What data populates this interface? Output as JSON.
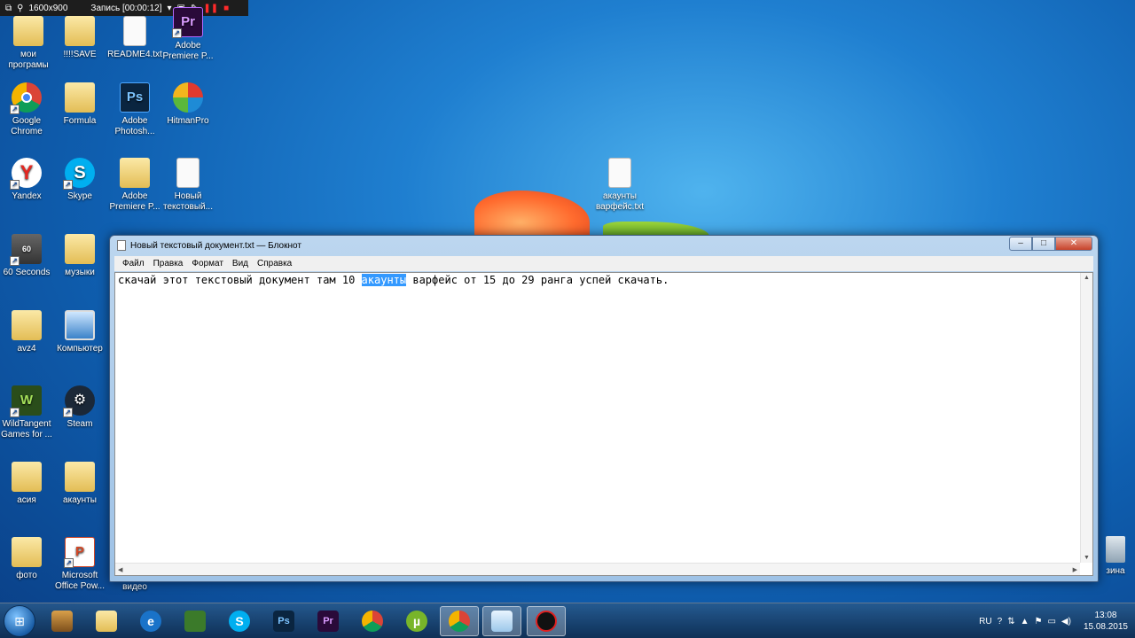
{
  "recorder": {
    "resolution": "1600x900",
    "status": "Запись [00:00:12]"
  },
  "desktop_icons": [
    {
      "label": "мои\nпрограмы"
    },
    {
      "label": "!!!!SAVE"
    },
    {
      "label": "README4.txt"
    },
    {
      "label": "Adobe\nPremiere P..."
    },
    {
      "label": "Google\nChrome"
    },
    {
      "label": "Formula"
    },
    {
      "label": "Adobe\nPhotosh..."
    },
    {
      "label": "HitmanPro"
    },
    {
      "label": "Yandex"
    },
    {
      "label": "Skype"
    },
    {
      "label": "Adobe\nPremiere P..."
    },
    {
      "label": "Новый\nтекстовый..."
    },
    {
      "label": "акаунты\nварфейс.txt"
    },
    {
      "label": "60 Seconds"
    },
    {
      "label": "музыки"
    },
    {
      "label": "avz4"
    },
    {
      "label": "Компьютер"
    },
    {
      "label": "WildTangent\nGames for ..."
    },
    {
      "label": "Steam"
    },
    {
      "label": "асия"
    },
    {
      "label": "акаунты"
    },
    {
      "label": "фото"
    },
    {
      "label": "Microsoft\nOffice Pow..."
    },
    {
      "label": "видео"
    },
    {
      "label": "зина"
    }
  ],
  "notepad": {
    "title": "Новый текстовый документ.txt — Блокнот",
    "menu": [
      "Файл",
      "Правка",
      "Формат",
      "Вид",
      "Справка"
    ],
    "text_before": "скачай этот текстовый документ там 10 ",
    "text_selected": "акаунты",
    "text_after": " варфейс от 15 до 29 ранга успей скачать."
  },
  "taskbar": {
    "apps": [
      "Проводник/игры",
      "Проводник",
      "Internet Explorer",
      "Игра",
      "Skype",
      "Photoshop",
      "Premiere",
      "Chrome",
      "uTorrent",
      "Chrome",
      "Блокнот",
      "Запись"
    ],
    "lang": "RU",
    "time": "13:08",
    "date": "15.08.2015"
  },
  "colors": {
    "selection": "#3399ff",
    "desktop": "#1f7fd0"
  }
}
